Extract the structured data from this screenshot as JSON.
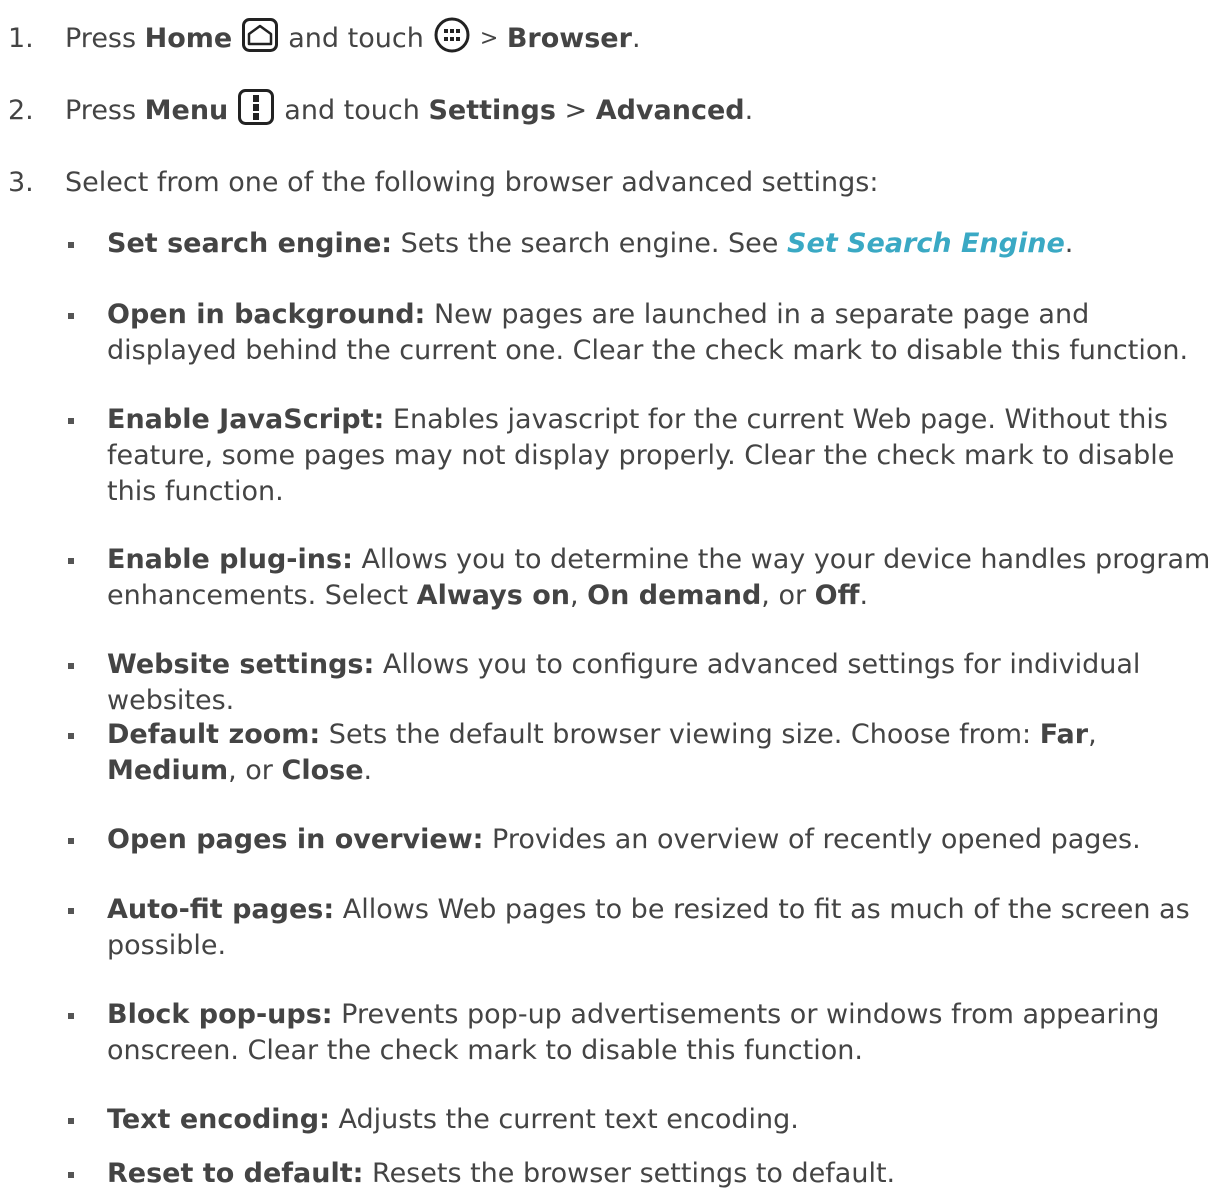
{
  "steps": [
    {
      "number": "1.",
      "pre": "Press",
      "key1": "Home",
      "key1_icon": "home-icon",
      "mid": "and touch",
      "key2_icon": "apps-icon",
      "sep": ">",
      "target": "Browser",
      "end": "."
    },
    {
      "number": "2.",
      "pre": "Press",
      "key1": "Menu",
      "key1_icon": "menu-icon",
      "mid": "and touch",
      "target1": "Settings",
      "sep": ">",
      "target2": "Advanced",
      "end": "."
    },
    {
      "number": "3.",
      "text": "Select from one of the following browser advanced settings:"
    }
  ],
  "items": [
    {
      "term": "Set search engine:",
      "text": " Sets the search engine. See ",
      "link": "Set Search Engine",
      "after": "."
    },
    {
      "term": "Open in background:",
      "text": " New pages are launched in a separate page and displayed behind the current one. Clear the check mark to disable this function."
    },
    {
      "term": "Enable JavaScript:",
      "text": " Enables javascript for the current Web page. Without this feature, some pages may not display properly. Clear the check mark to disable this function."
    },
    {
      "term": "Enable plug-ins:",
      "text": " Allows you to determine the way your device handles program enhancements. Select ",
      "opt1": "Always on",
      "c1": ", ",
      "opt2": "On demand",
      "c2": ", or ",
      "opt3": "Off",
      "after": "."
    },
    {
      "term": "Website settings:",
      "text": " Allows you to configure advanced settings for individual websites."
    },
    {
      "term": "Default zoom:",
      "text": " Sets the default browser viewing size. Choose from: ",
      "opt1": "Far",
      "c1": ", ",
      "opt2": "Medium",
      "c2": ", or ",
      "opt3": "Close",
      "after": "."
    },
    {
      "term": "Open pages in overview:",
      "text": " Provides an overview of recently opened pages."
    },
    {
      "term": "Auto-fit pages:",
      "text": " Allows Web pages to be resized to fit as much of the screen as possible."
    },
    {
      "term": "Block pop-ups:",
      "text": " Prevents pop-up advertisements or windows from appearing onscreen. Clear the check mark to disable this function."
    },
    {
      "term": "Text encoding:",
      "text": " Adjusts the current text encoding."
    },
    {
      "term": "Reset to default:",
      "text": " Resets the browser settings to default."
    }
  ]
}
